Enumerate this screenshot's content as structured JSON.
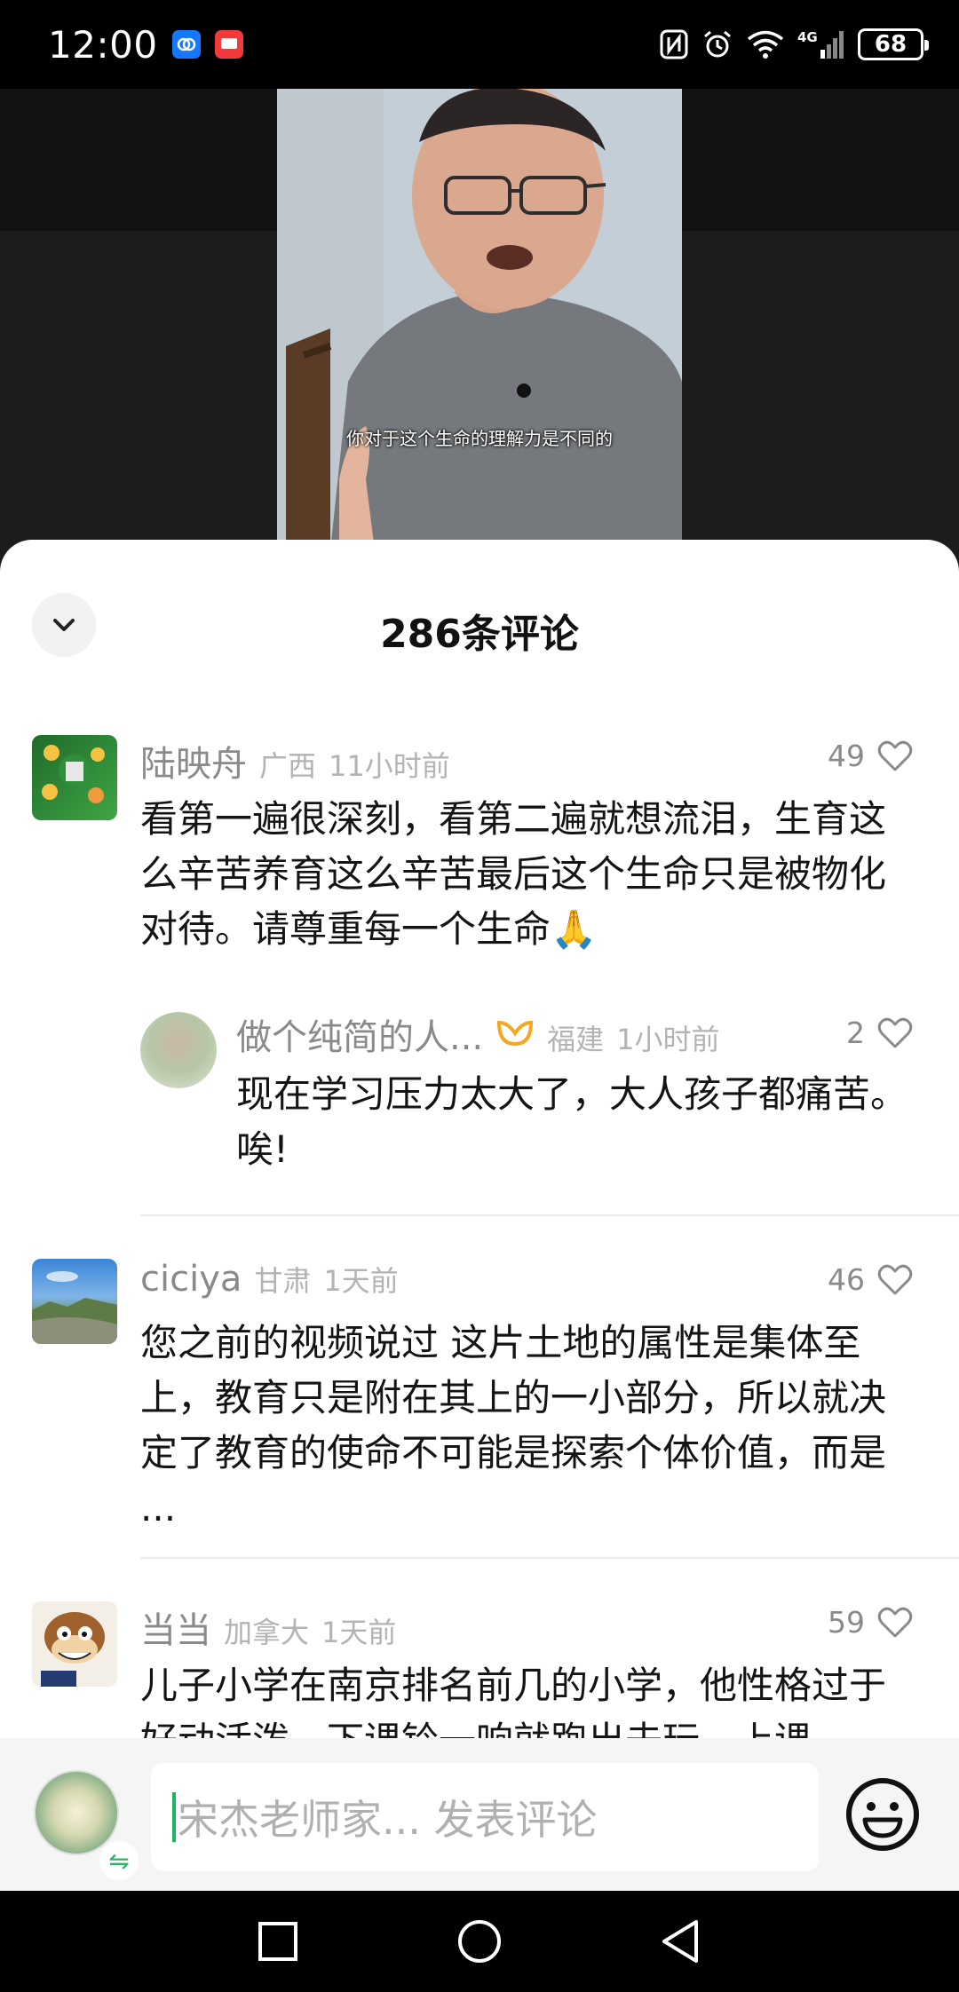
{
  "status_bar": {
    "time": "12:00",
    "network": "4G",
    "battery": "68"
  },
  "video": {
    "subtitle": "你对于这个生命的理解力是不同的"
  },
  "sheet": {
    "title": "286条评论"
  },
  "comments": [
    {
      "name": "陆映舟",
      "location": "广西",
      "time": "11小时前",
      "likes": "49",
      "text": "看第一遍很深刻，看第二遍就想流泪，生育这么辛苦养育这么辛苦最后这个生命只是被物化对待。请尊重每一个生命🙏"
    },
    {
      "name": "做个纯简的人...",
      "location": "福建",
      "time": "1小时前",
      "likes": "2",
      "text": "现在学习压力太大了，大人孩子都痛苦。唉!"
    },
    {
      "name": "ciciya",
      "location": "甘肃",
      "time": "1天前",
      "likes": "46",
      "text": "您之前的视频说过 这片土地的属性是集体至上，教育只是附在其上的一小部分，所以就决定了教育的使命不可能是探索个体价值，而是 ..."
    },
    {
      "name": "当当",
      "location": "加拿大",
      "time": "1天前",
      "likes": "59",
      "text": "儿子小学在南京排名前几的小学，他性格过于好动活泼，下课铃一响就跑出去玩，上课"
    }
  ],
  "input": {
    "placeholder": "宋杰老师家... 发表评论"
  },
  "colors": {
    "accent_green": "#18b55e",
    "like_gray": "#8a8a8a",
    "vip_orange": "#f5a623"
  },
  "icons": [
    "chevron-down-icon",
    "heart-icon",
    "vip-icon",
    "emoji-icon",
    "swap-icon",
    "nav-recents-icon",
    "nav-home-icon",
    "nav-back-icon"
  ]
}
